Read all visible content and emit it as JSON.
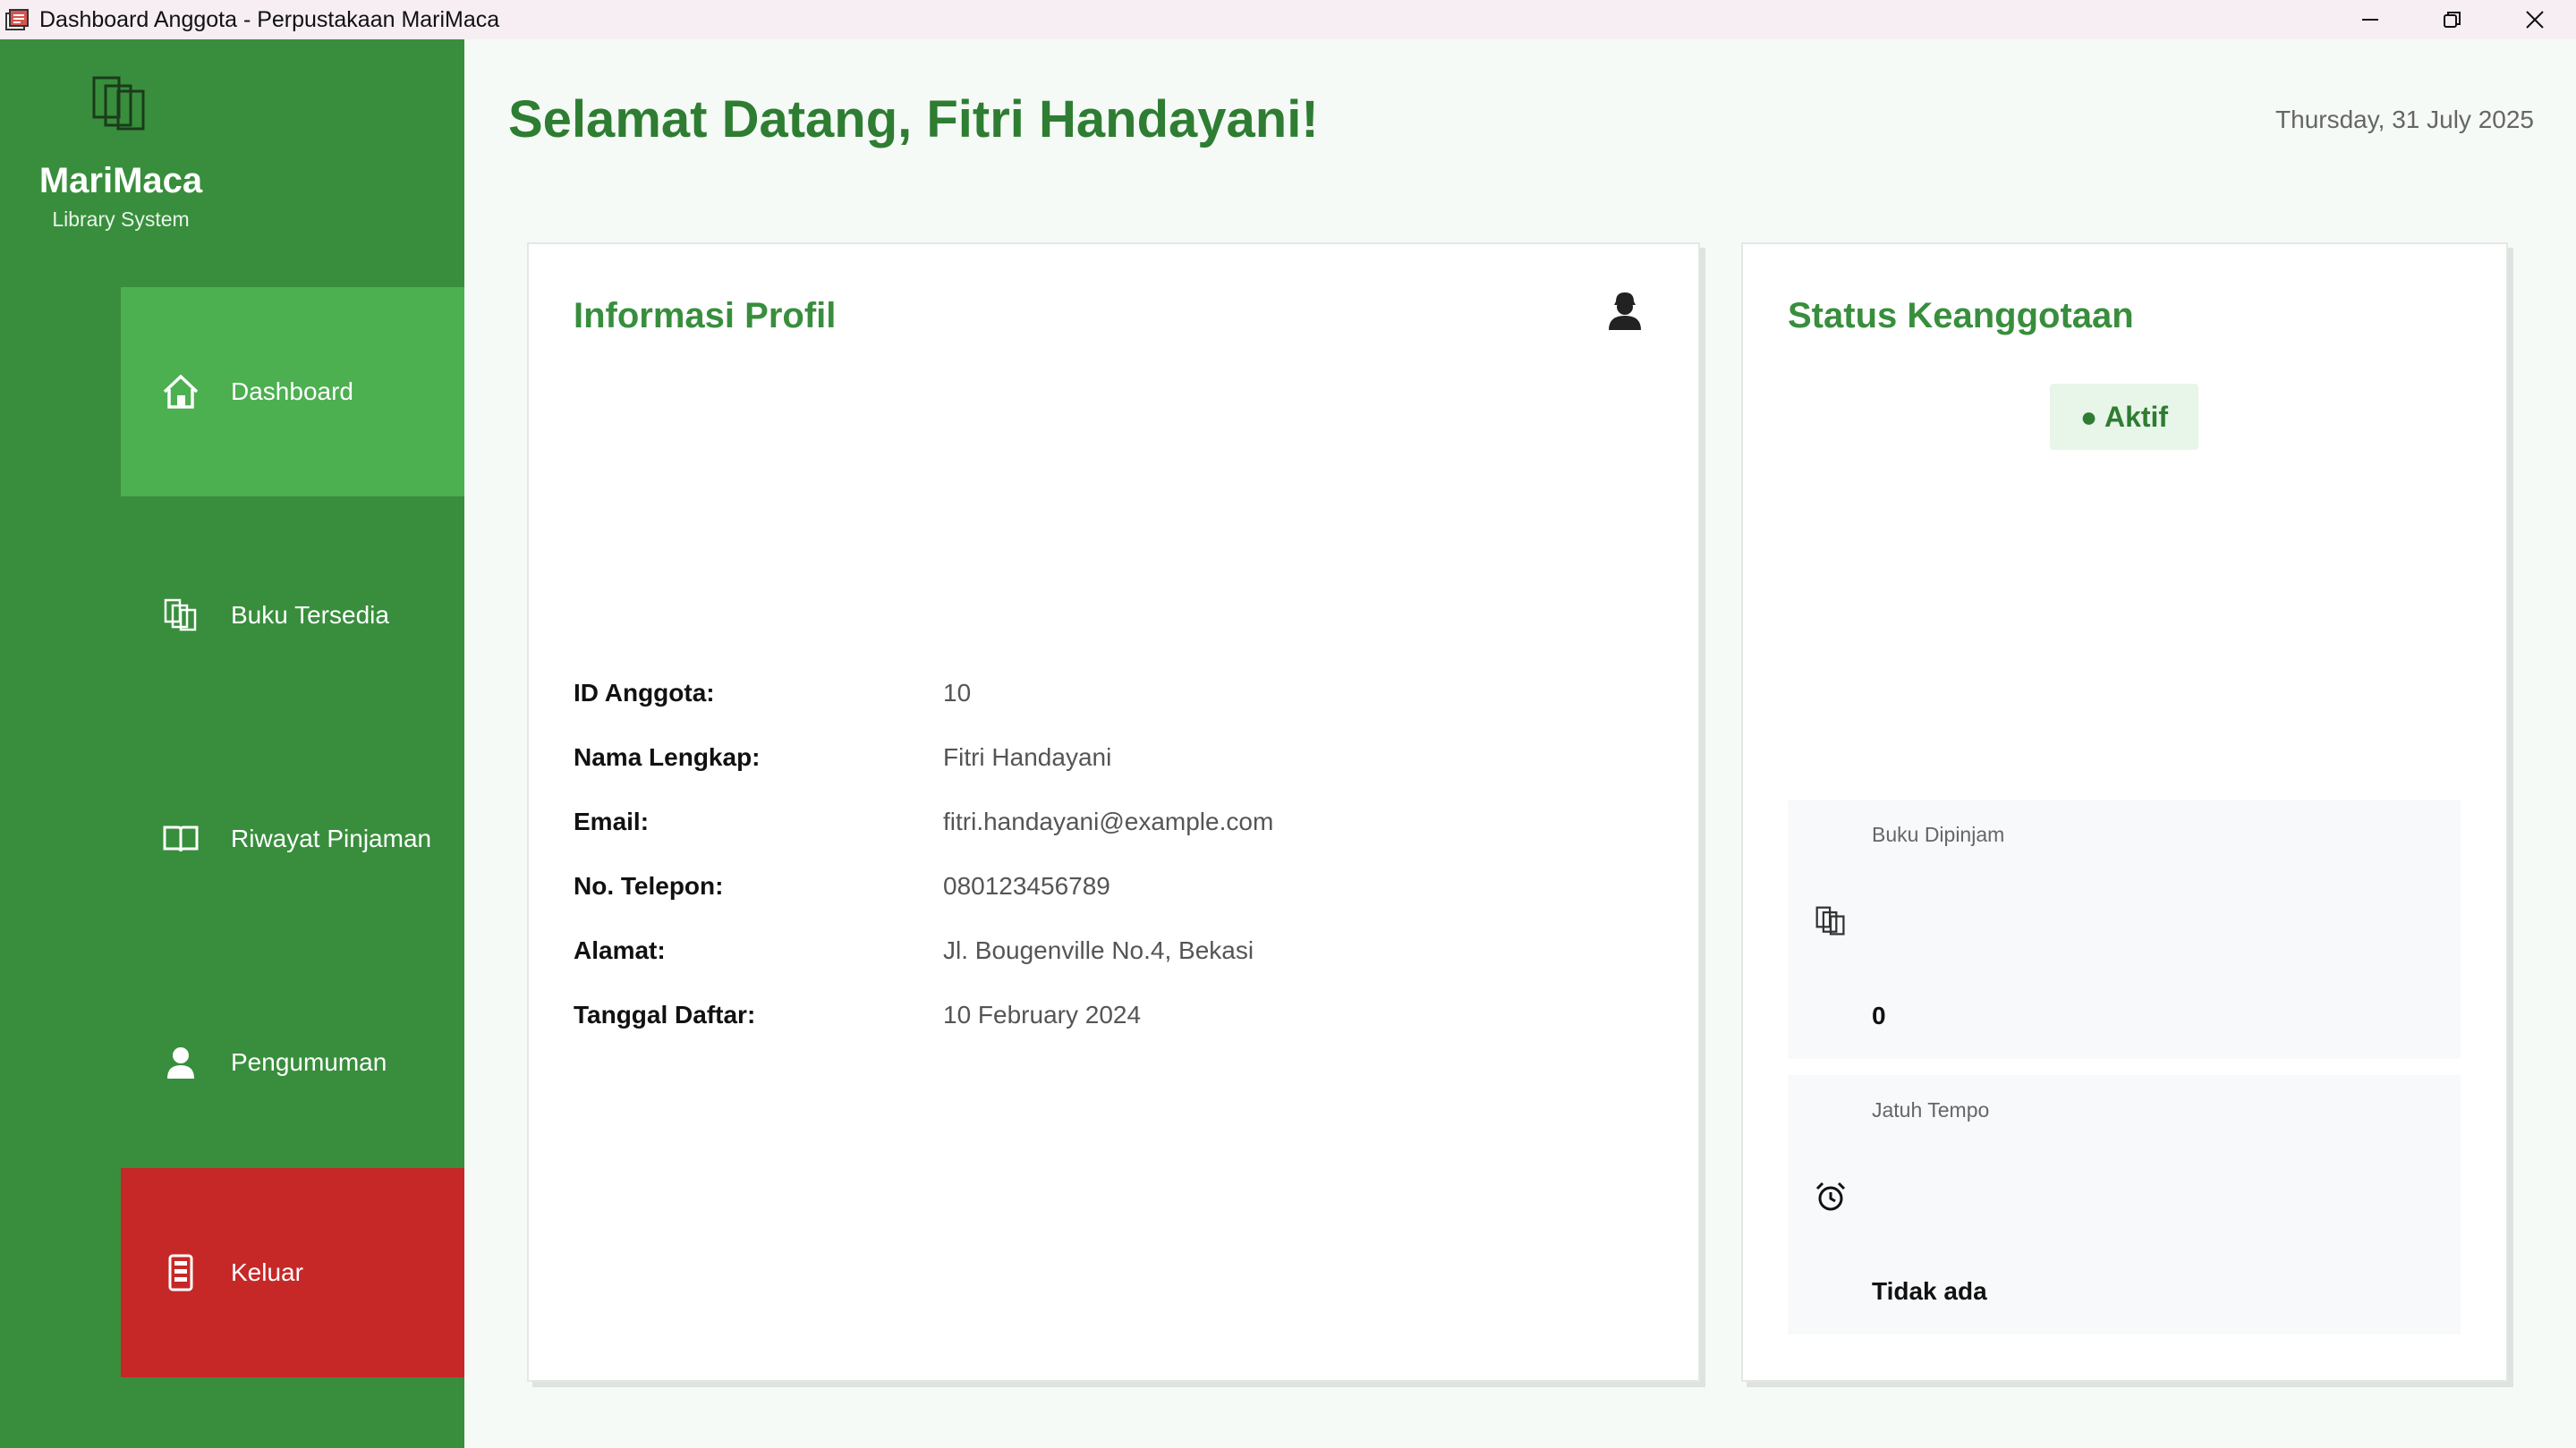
{
  "window": {
    "title": "Dashboard Anggota - Perpustakaan MariMaca",
    "controls": [
      "minimize",
      "restore",
      "close"
    ]
  },
  "sidebar": {
    "brand_name": "MariMaca",
    "brand_subtitle": "Library System",
    "items": [
      {
        "label": "Dashboard",
        "icon": "home-icon",
        "active": true
      },
      {
        "label": "Buku Tersedia",
        "icon": "books-icon"
      },
      {
        "label": "Riwayat Pinjaman",
        "icon": "open-book-icon"
      },
      {
        "label": "Pengumuman",
        "icon": "user-icon"
      },
      {
        "label": "Keluar",
        "icon": "logout-icon"
      }
    ]
  },
  "header": {
    "welcome": "Selamat Datang, Fitri Handayani!",
    "date": "Thursday, 31 July 2025"
  },
  "profile": {
    "title": "Informasi Profil",
    "rows": [
      {
        "label": "ID Anggota:",
        "value": "10"
      },
      {
        "label": "Nama Lengkap:",
        "value": "Fitri Handayani"
      },
      {
        "label": "Email:",
        "value": "fitri.handayani@example.com"
      },
      {
        "label": "No. Telepon:",
        "value": "080123456789"
      },
      {
        "label": "Alamat:",
        "value": "Jl. Bougenville No.4, Bekasi"
      },
      {
        "label": "Tanggal Daftar:",
        "value": "10 February 2024"
      }
    ]
  },
  "status": {
    "title": "Status Keanggotaan",
    "badge": "● Aktif",
    "stats": [
      {
        "label": "Buku Dipinjam",
        "value": "0",
        "icon": "books-icon"
      },
      {
        "label": "Jatuh Tempo",
        "value": "Tidak ada",
        "icon": "alarm-clock-icon"
      }
    ]
  },
  "colors": {
    "sidebar": "#388e3c",
    "active": "#4caf50",
    "logout": "#c62828",
    "heading": "#2e7d32"
  }
}
